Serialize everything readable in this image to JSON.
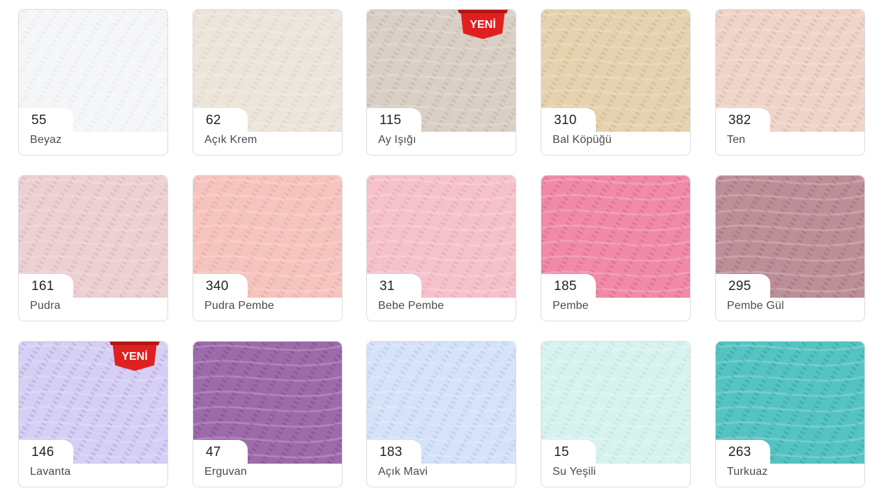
{
  "badge_label": "YENİ",
  "colors": [
    {
      "code": "55",
      "name": "Beyaz",
      "swatch": "#f5f6f8",
      "stroke": "#e2e4e8",
      "new": false
    },
    {
      "code": "62",
      "name": "Açık Krem",
      "swatch": "#ece5da",
      "stroke": "#d9cfc0",
      "new": false
    },
    {
      "code": "115",
      "name": "Ay Işığı",
      "swatch": "#d9cfc5",
      "stroke": "#b9aca0",
      "new": true
    },
    {
      "code": "310",
      "name": "Bal Köpüğü",
      "swatch": "#e5d2ae",
      "stroke": "#c8b287",
      "new": false
    },
    {
      "code": "382",
      "name": "Ten",
      "swatch": "#efd4c9",
      "stroke": "#d3aea0",
      "new": false
    },
    {
      "code": "161",
      "name": "Pudra",
      "swatch": "#ecd0d2",
      "stroke": "#d4aeb2",
      "new": false
    },
    {
      "code": "340",
      "name": "Pudra Pembe",
      "swatch": "#f6c4be",
      "stroke": "#e3a49d",
      "new": false
    },
    {
      "code": "31",
      "name": "Bebe Pembe",
      "swatch": "#f5c2cc",
      "stroke": "#e2a0ae",
      "new": false
    },
    {
      "code": "185",
      "name": "Pembe",
      "swatch": "#f08aa8",
      "stroke": "#d85f86",
      "new": false
    },
    {
      "code": "295",
      "name": "Pembe Gül",
      "swatch": "#bc8f98",
      "stroke": "#9a6b75",
      "new": false
    },
    {
      "code": "146",
      "name": "Lavanta",
      "swatch": "#d6cff3",
      "stroke": "#a79be0",
      "new": true
    },
    {
      "code": "47",
      "name": "Erguvan",
      "swatch": "#9d6aaa",
      "stroke": "#7a4c88",
      "new": false
    },
    {
      "code": "183",
      "name": "Açık Mavi",
      "swatch": "#d5e2f7",
      "stroke": "#aec4ec",
      "new": false
    },
    {
      "code": "15",
      "name": "Su Yeşili",
      "swatch": "#d8f3ef",
      "stroke": "#b2e2da",
      "new": false
    },
    {
      "code": "263",
      "name": "Turkuaz",
      "swatch": "#56c3c3",
      "stroke": "#2f9ea0",
      "new": false
    }
  ]
}
